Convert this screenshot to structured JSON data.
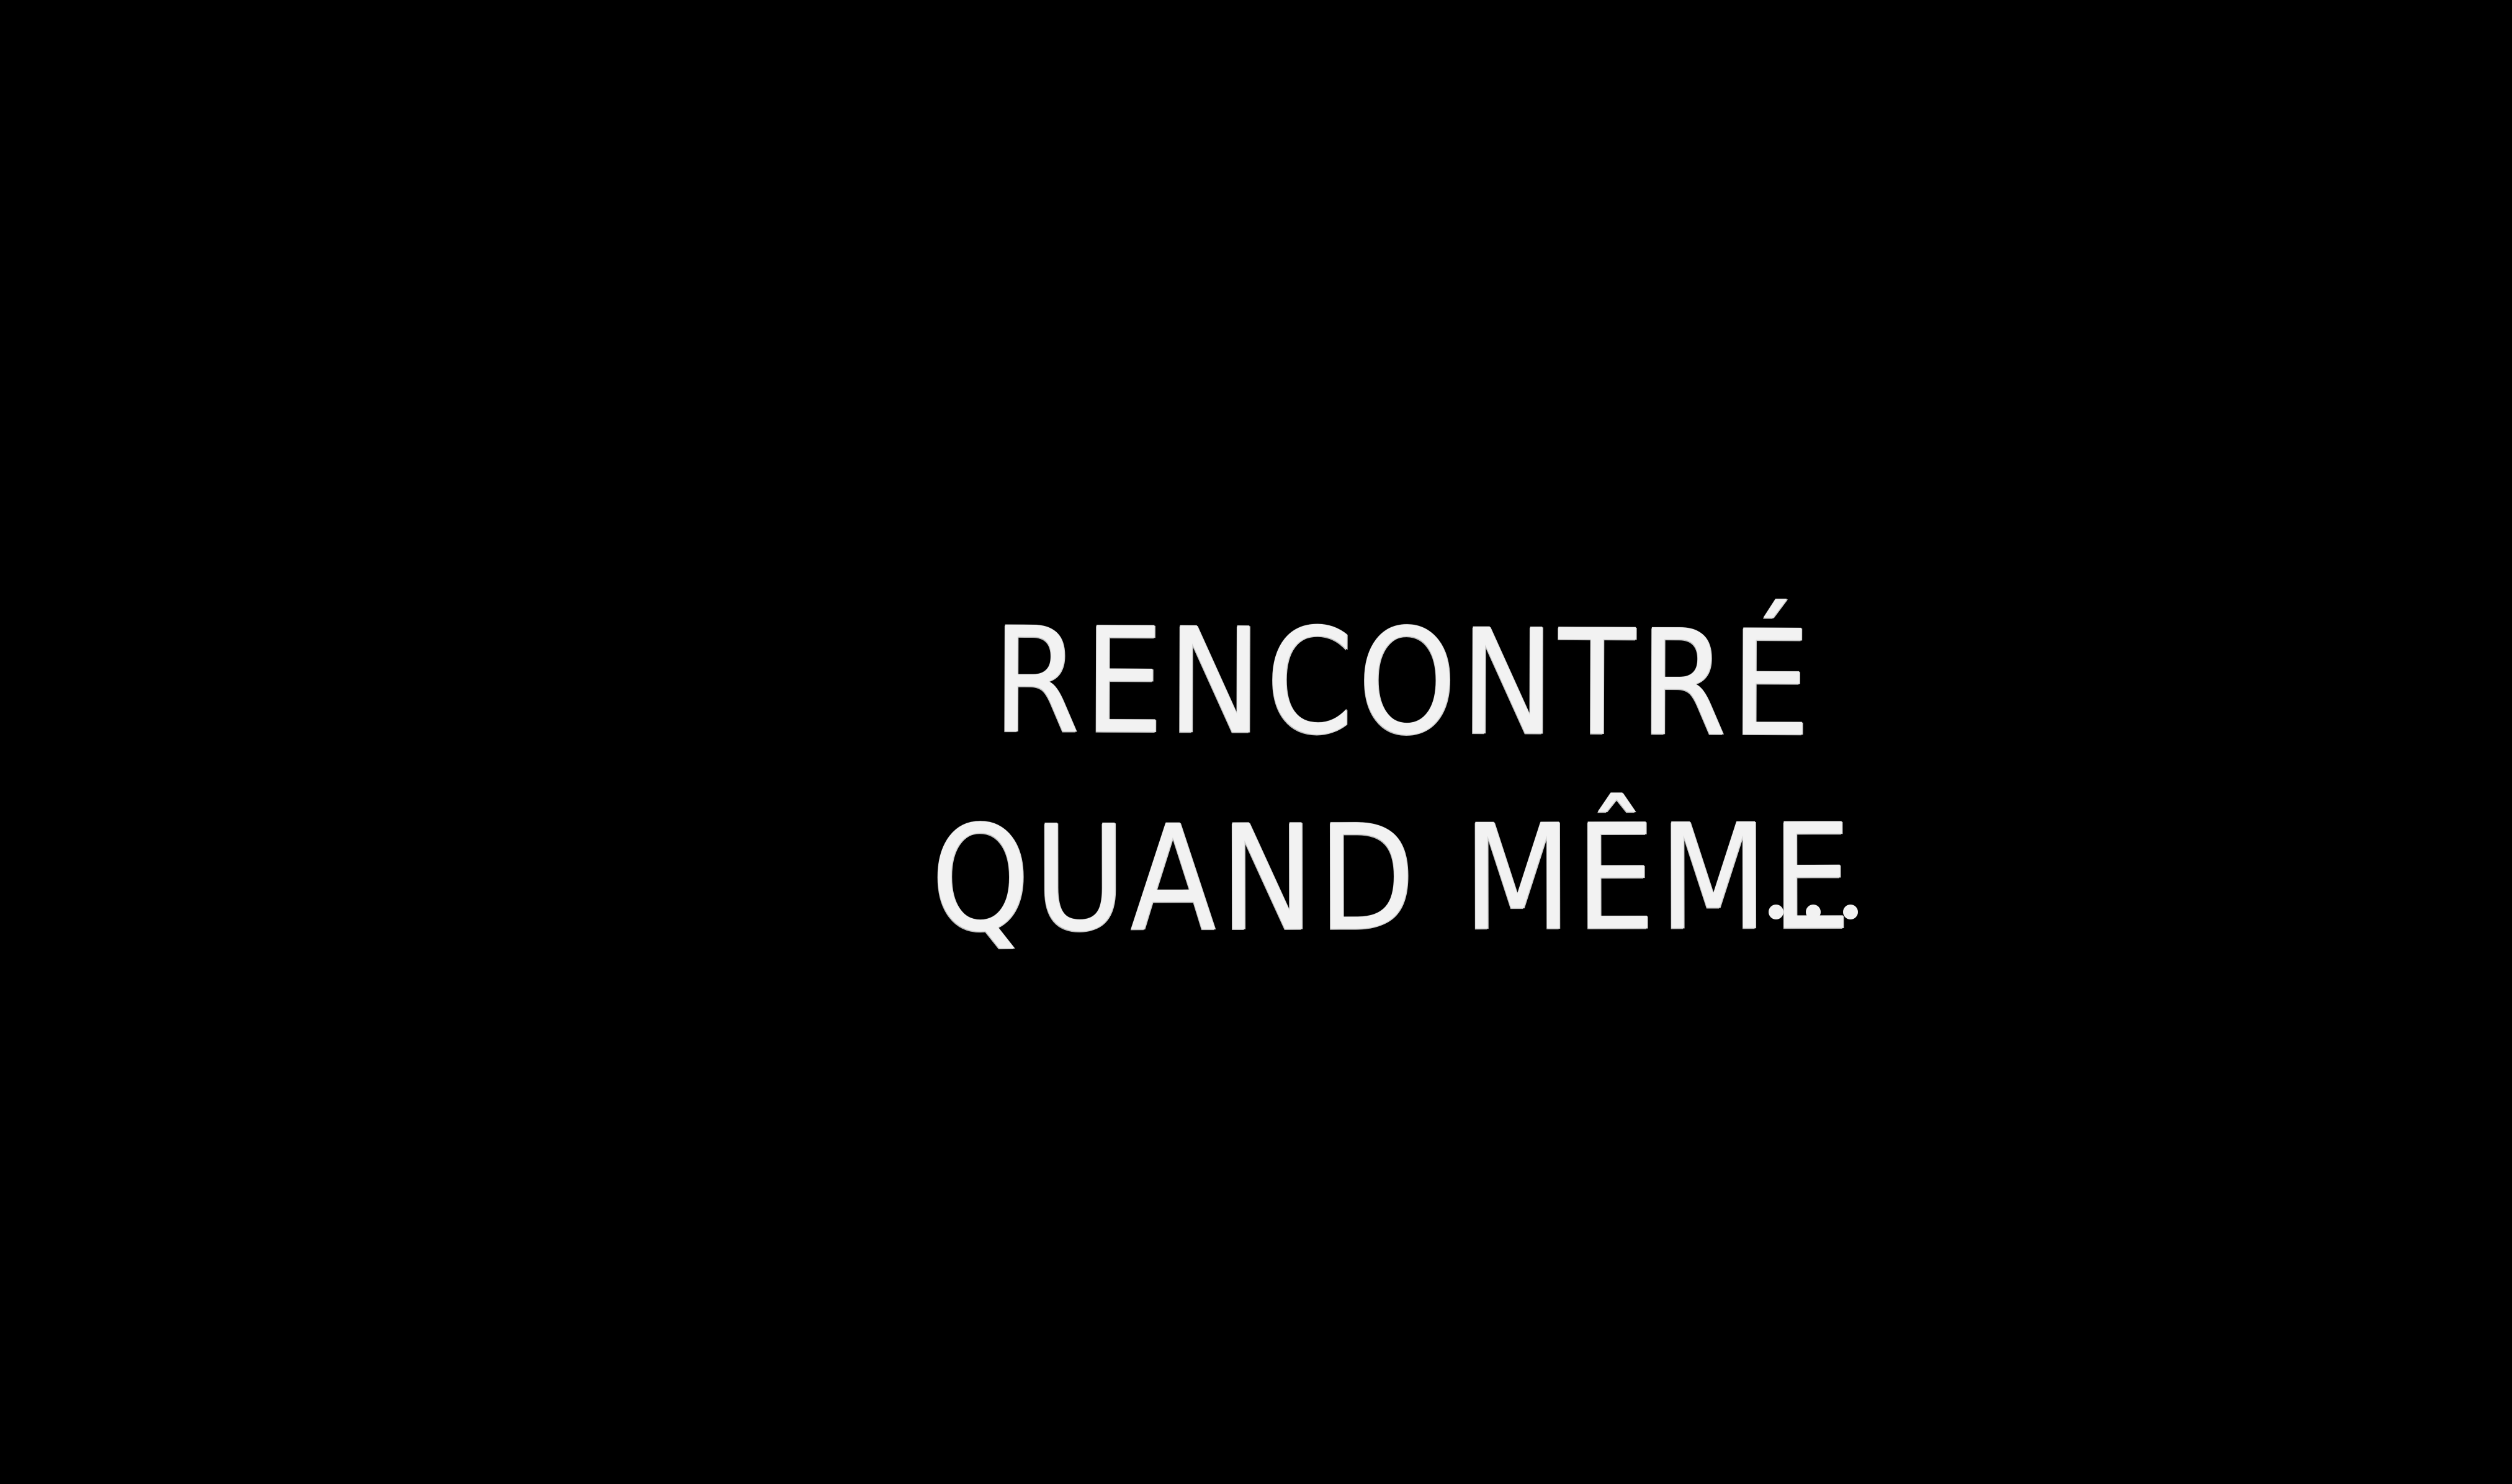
{
  "scene": {
    "background_color": "#000000",
    "text_color": "#f2f2f2",
    "caption": {
      "line1": "RENCONTRÉ",
      "line2": "QUAND MÊME",
      "ellipsis": "..."
    }
  }
}
